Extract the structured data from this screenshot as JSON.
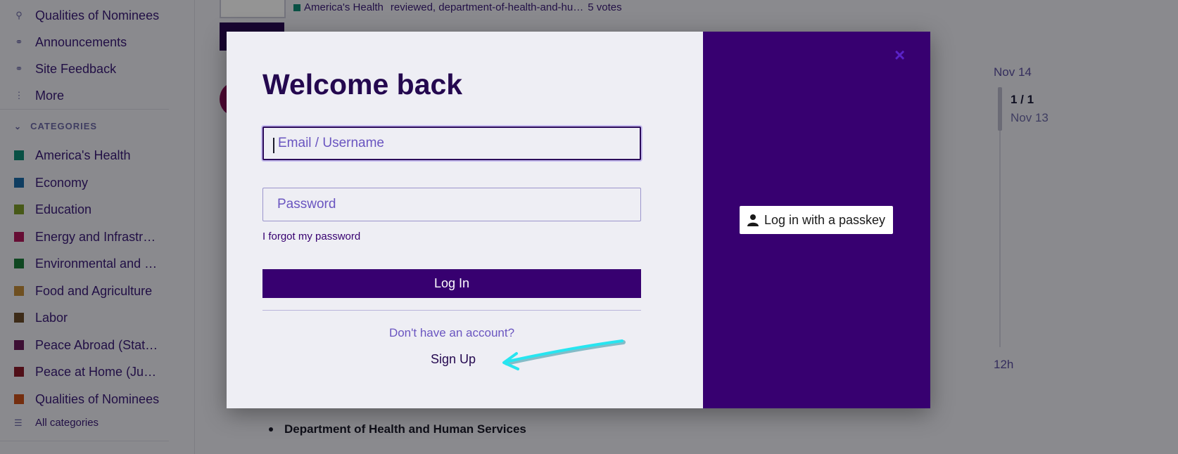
{
  "sidebar": {
    "links": [
      {
        "label": "Qualities of Nominees",
        "icon": "ribbon-icon"
      },
      {
        "label": "Announcements",
        "icon": "link-icon"
      },
      {
        "label": "Site Feedback",
        "icon": "link-icon"
      },
      {
        "label": "More",
        "icon": "vertical-ellipsis-icon"
      }
    ],
    "categories_heading": "CATEGORIES",
    "categories": [
      {
        "label": "America's Health",
        "color": "#0e8a76"
      },
      {
        "label": "Economy",
        "color": "#1a6aa8"
      },
      {
        "label": "Education",
        "color": "#7a9a2a"
      },
      {
        "label": "Energy and Infrastr…",
        "color": "#b0185a"
      },
      {
        "label": "Environmental and …",
        "color": "#1a7a3a"
      },
      {
        "label": "Food and Agriculture",
        "color": "#c08a3a"
      },
      {
        "label": "Labor",
        "color": "#6a4a2a"
      },
      {
        "label": "Peace Abroad (Stat…",
        "color": "#6a1a5a"
      },
      {
        "label": "Peace at Home (Ju…",
        "color": "#8a1a2a"
      },
      {
        "label": "Qualities of Nominees",
        "color": "#c8501a"
      }
    ],
    "all_categories": "All categories"
  },
  "topic": {
    "category": "America's Health",
    "tags": "reviewed, department-of-health-and-hu…",
    "votes": "5 votes"
  },
  "timeline": {
    "top_date": "Nov 14",
    "position": "1 / 1",
    "position_date": "Nov 13",
    "bottom_date": "12h"
  },
  "post": {
    "bullet_text": "Department of Health and Human Services"
  },
  "modal": {
    "title": "Welcome back",
    "email_placeholder": "Email / Username",
    "email_value": "",
    "password_placeholder": "Password",
    "password_value": "",
    "forgot_link": "I forgot my password",
    "login_button": "Log In",
    "no_account_text": "Don't have an account?",
    "signup_link": "Sign Up",
    "close_icon": "×",
    "passkey_button": "Log in with a passkey"
  },
  "colors": {
    "brand": "#370070",
    "heading": "#24084f",
    "link": "#6a55c0",
    "annotation_arrow": "#27e5f0"
  }
}
